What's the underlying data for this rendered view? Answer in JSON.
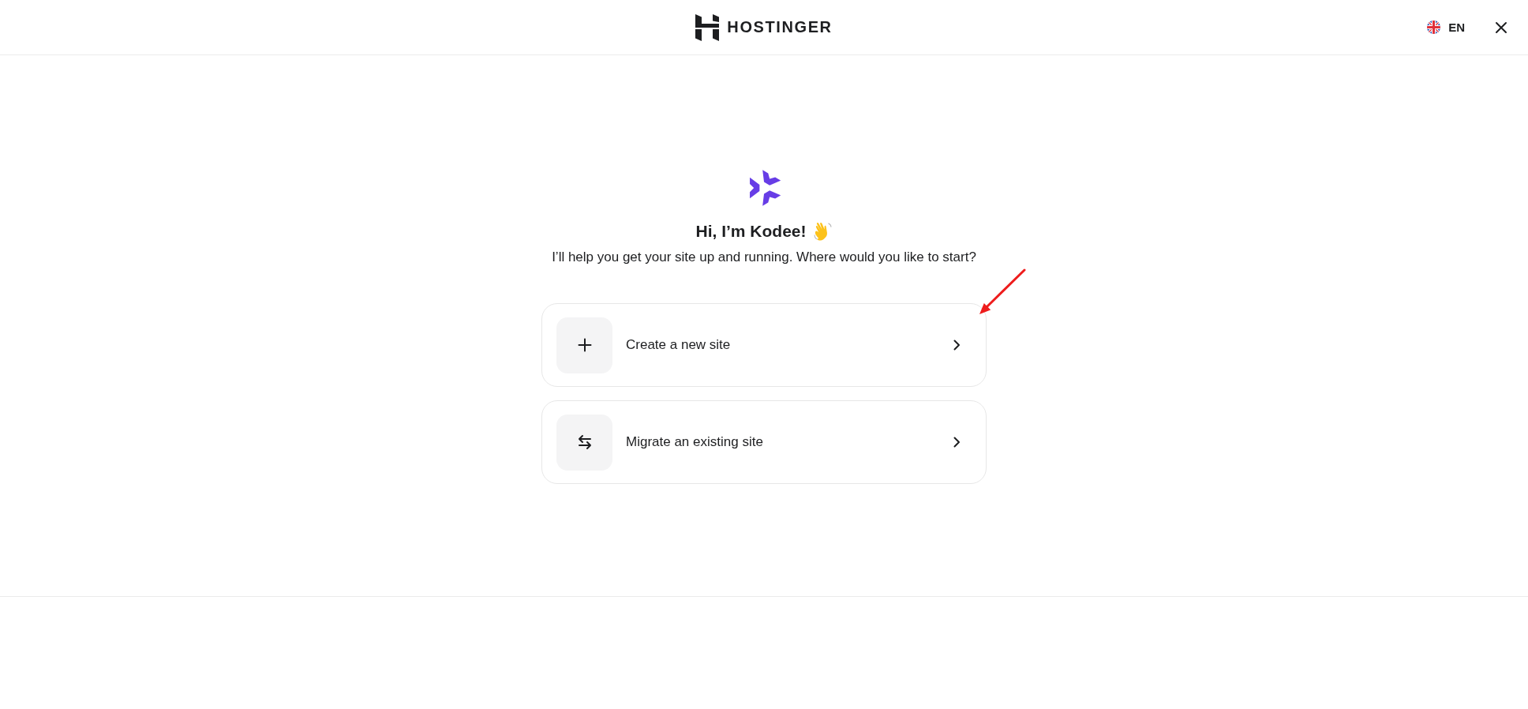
{
  "header": {
    "brand": "HOSTINGER",
    "language": "EN"
  },
  "intro": {
    "heading": "Hi, I’m Kodee!",
    "subtitle": "I’ll help you get your site up and running. Where would you like to start?"
  },
  "options": [
    {
      "kind": "create",
      "label": "Create a new site"
    },
    {
      "kind": "migrate",
      "label": "Migrate an existing site"
    }
  ]
}
